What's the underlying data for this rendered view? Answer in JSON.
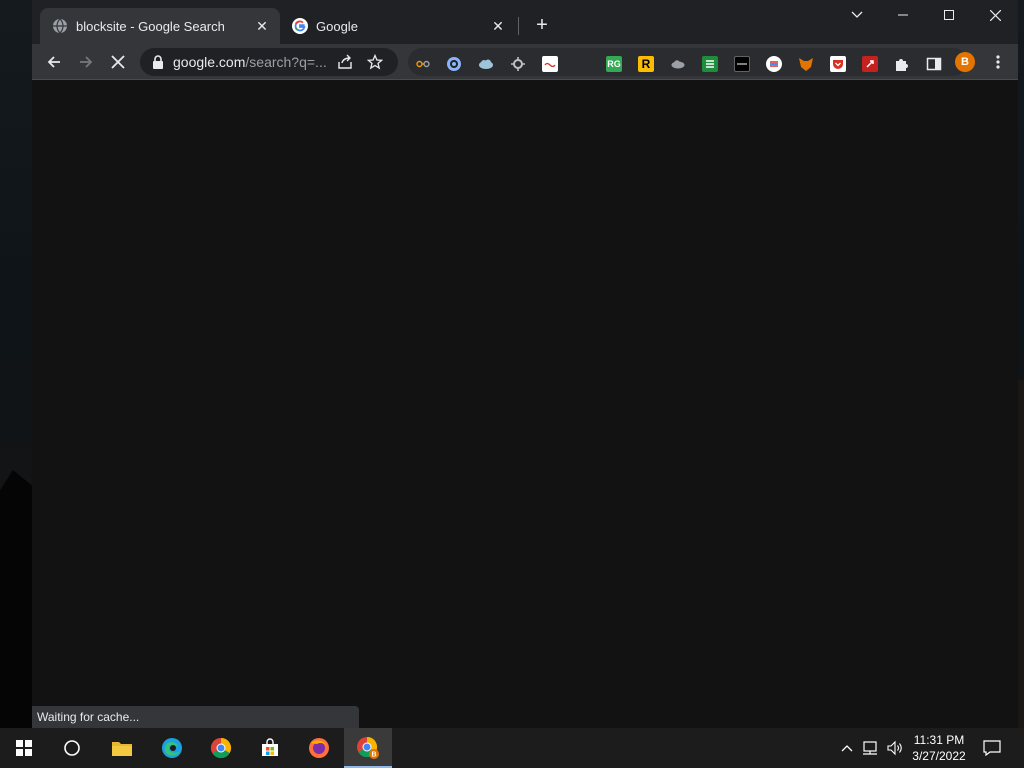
{
  "tabs": [
    {
      "title": "blocksite - Google Search",
      "favicon": "globe-icon",
      "active": true
    },
    {
      "title": "Google",
      "favicon": "google-g-icon",
      "active": false
    }
  ],
  "omnibox": {
    "url_host": "google.com",
    "url_rest": "/search?q=..."
  },
  "extensions": [
    {
      "name": "link-ext-icon",
      "label": "",
      "bg": "#2b2c2f",
      "fg": "#f29900"
    },
    {
      "name": "shield-ext-icon",
      "label": "",
      "bg": "#2b2c2f",
      "fg": "#8ab4f8"
    },
    {
      "name": "cloud-ext-icon",
      "label": "",
      "bg": "#2b2c2f",
      "fg": "#9fc3d8"
    },
    {
      "name": "gear-ext-icon",
      "label": "",
      "bg": "#2b2c2f",
      "fg": "#bdc1c6"
    },
    {
      "name": "card-ext-icon",
      "label": "",
      "bg": "#ffffff",
      "fg": "#d93025"
    },
    {
      "name": "rg-ext-icon",
      "label": "RG",
      "bg": "#34a853",
      "fg": "#ffffff"
    },
    {
      "name": "r-ext-icon",
      "label": "R",
      "bg": "#fbbc04",
      "fg": "#000000"
    },
    {
      "name": "cloud2-ext-icon",
      "label": "",
      "bg": "#2b2c2f",
      "fg": "#9aa0a6"
    },
    {
      "name": "list-ext-icon",
      "label": "",
      "bg": "#1e8e3e",
      "fg": "#ffffff"
    },
    {
      "name": "dark-ext-icon",
      "label": "",
      "bg": "#000000",
      "fg": "#ffffff"
    },
    {
      "name": "swirl-ext-icon",
      "label": "",
      "bg": "#ffffff",
      "fg": "#d93025"
    },
    {
      "name": "fox-ext-icon",
      "label": "",
      "bg": "#2b2c2f",
      "fg": "#e37400"
    },
    {
      "name": "pocket-ext-icon",
      "label": "",
      "bg": "#ffffff",
      "fg": "#d93025"
    },
    {
      "name": "red-ext-icon",
      "label": "",
      "bg": "#c5221f",
      "fg": "#ffffff"
    }
  ],
  "profile": {
    "initial": "B",
    "color": "#e37400"
  },
  "status": {
    "text": "Waiting for cache..."
  },
  "taskbar": {
    "apps": [
      "windows-start-icon",
      "search-circle-icon",
      "file-explorer-icon",
      "edge-icon",
      "chrome-icon",
      "store-icon",
      "firefox-icon",
      "chrome-profile-icon"
    ]
  },
  "clock": {
    "time": "11:31 PM",
    "date": "3/27/2022"
  }
}
